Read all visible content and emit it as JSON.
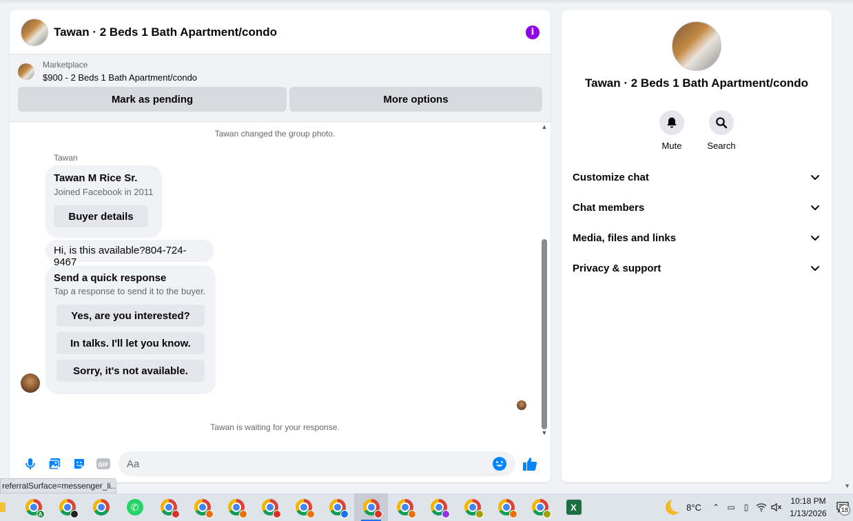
{
  "chat": {
    "title": "Tawan · 2 Beds 1 Bath Apartment/condo",
    "marketplace": {
      "label": "Marketplace",
      "listing": "$900 - 2 Beds 1 Bath Apartment/condo",
      "mark_pending": "Mark as pending",
      "more_options": "More options"
    },
    "system_group_photo": "Tawan changed the group photo.",
    "sender_name": "Tawan",
    "buyer_card": {
      "name": "Tawan M Rice Sr.",
      "joined": "Joined Facebook in 2011",
      "details_button": "Buyer details"
    },
    "message": "Hi, is this available?804-724-9467",
    "quick_response": {
      "title": "Send a quick response",
      "subtitle": "Tap a response to send it to the buyer.",
      "options": [
        "Yes, are you interested?",
        "In talks. I'll let you know.",
        "Sorry, it's not available."
      ]
    },
    "waiting": "Tawan is waiting for your response.",
    "composer_placeholder": "Aa"
  },
  "info_panel": {
    "title": "Tawan · 2 Beds 1 Bath Apartment/condo",
    "mute": "Mute",
    "search": "Search",
    "sections": [
      "Customize chat",
      "Chat members",
      "Media, files and links",
      "Privacy & support"
    ]
  },
  "status_url": "referralSurface=messenger_li...",
  "taskbar": {
    "weather": "8°C",
    "time": "10:18 PM",
    "date": "1/13/2026",
    "notifications": "18"
  },
  "colors": {
    "accent": "#0084ff",
    "info_purple": "#8e00e6",
    "bubble": "#f0f2f5"
  }
}
